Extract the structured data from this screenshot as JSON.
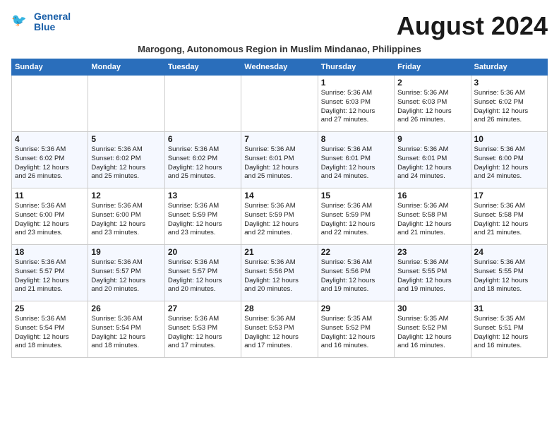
{
  "header": {
    "logo_line1": "General",
    "logo_line2": "Blue",
    "month_title": "August 2024",
    "subtitle": "Marogong, Autonomous Region in Muslim Mindanao, Philippines"
  },
  "weekdays": [
    "Sunday",
    "Monday",
    "Tuesday",
    "Wednesday",
    "Thursday",
    "Friday",
    "Saturday"
  ],
  "weeks": [
    [
      {
        "day": "",
        "detail": ""
      },
      {
        "day": "",
        "detail": ""
      },
      {
        "day": "",
        "detail": ""
      },
      {
        "day": "",
        "detail": ""
      },
      {
        "day": "1",
        "detail": "Sunrise: 5:36 AM\nSunset: 6:03 PM\nDaylight: 12 hours\nand 27 minutes."
      },
      {
        "day": "2",
        "detail": "Sunrise: 5:36 AM\nSunset: 6:03 PM\nDaylight: 12 hours\nand 26 minutes."
      },
      {
        "day": "3",
        "detail": "Sunrise: 5:36 AM\nSunset: 6:02 PM\nDaylight: 12 hours\nand 26 minutes."
      }
    ],
    [
      {
        "day": "4",
        "detail": "Sunrise: 5:36 AM\nSunset: 6:02 PM\nDaylight: 12 hours\nand 26 minutes."
      },
      {
        "day": "5",
        "detail": "Sunrise: 5:36 AM\nSunset: 6:02 PM\nDaylight: 12 hours\nand 25 minutes."
      },
      {
        "day": "6",
        "detail": "Sunrise: 5:36 AM\nSunset: 6:02 PM\nDaylight: 12 hours\nand 25 minutes."
      },
      {
        "day": "7",
        "detail": "Sunrise: 5:36 AM\nSunset: 6:01 PM\nDaylight: 12 hours\nand 25 minutes."
      },
      {
        "day": "8",
        "detail": "Sunrise: 5:36 AM\nSunset: 6:01 PM\nDaylight: 12 hours\nand 24 minutes."
      },
      {
        "day": "9",
        "detail": "Sunrise: 5:36 AM\nSunset: 6:01 PM\nDaylight: 12 hours\nand 24 minutes."
      },
      {
        "day": "10",
        "detail": "Sunrise: 5:36 AM\nSunset: 6:00 PM\nDaylight: 12 hours\nand 24 minutes."
      }
    ],
    [
      {
        "day": "11",
        "detail": "Sunrise: 5:36 AM\nSunset: 6:00 PM\nDaylight: 12 hours\nand 23 minutes."
      },
      {
        "day": "12",
        "detail": "Sunrise: 5:36 AM\nSunset: 6:00 PM\nDaylight: 12 hours\nand 23 minutes."
      },
      {
        "day": "13",
        "detail": "Sunrise: 5:36 AM\nSunset: 5:59 PM\nDaylight: 12 hours\nand 23 minutes."
      },
      {
        "day": "14",
        "detail": "Sunrise: 5:36 AM\nSunset: 5:59 PM\nDaylight: 12 hours\nand 22 minutes."
      },
      {
        "day": "15",
        "detail": "Sunrise: 5:36 AM\nSunset: 5:59 PM\nDaylight: 12 hours\nand 22 minutes."
      },
      {
        "day": "16",
        "detail": "Sunrise: 5:36 AM\nSunset: 5:58 PM\nDaylight: 12 hours\nand 21 minutes."
      },
      {
        "day": "17",
        "detail": "Sunrise: 5:36 AM\nSunset: 5:58 PM\nDaylight: 12 hours\nand 21 minutes."
      }
    ],
    [
      {
        "day": "18",
        "detail": "Sunrise: 5:36 AM\nSunset: 5:57 PM\nDaylight: 12 hours\nand 21 minutes."
      },
      {
        "day": "19",
        "detail": "Sunrise: 5:36 AM\nSunset: 5:57 PM\nDaylight: 12 hours\nand 20 minutes."
      },
      {
        "day": "20",
        "detail": "Sunrise: 5:36 AM\nSunset: 5:57 PM\nDaylight: 12 hours\nand 20 minutes."
      },
      {
        "day": "21",
        "detail": "Sunrise: 5:36 AM\nSunset: 5:56 PM\nDaylight: 12 hours\nand 20 minutes."
      },
      {
        "day": "22",
        "detail": "Sunrise: 5:36 AM\nSunset: 5:56 PM\nDaylight: 12 hours\nand 19 minutes."
      },
      {
        "day": "23",
        "detail": "Sunrise: 5:36 AM\nSunset: 5:55 PM\nDaylight: 12 hours\nand 19 minutes."
      },
      {
        "day": "24",
        "detail": "Sunrise: 5:36 AM\nSunset: 5:55 PM\nDaylight: 12 hours\nand 18 minutes."
      }
    ],
    [
      {
        "day": "25",
        "detail": "Sunrise: 5:36 AM\nSunset: 5:54 PM\nDaylight: 12 hours\nand 18 minutes."
      },
      {
        "day": "26",
        "detail": "Sunrise: 5:36 AM\nSunset: 5:54 PM\nDaylight: 12 hours\nand 18 minutes."
      },
      {
        "day": "27",
        "detail": "Sunrise: 5:36 AM\nSunset: 5:53 PM\nDaylight: 12 hours\nand 17 minutes."
      },
      {
        "day": "28",
        "detail": "Sunrise: 5:36 AM\nSunset: 5:53 PM\nDaylight: 12 hours\nand 17 minutes."
      },
      {
        "day": "29",
        "detail": "Sunrise: 5:35 AM\nSunset: 5:52 PM\nDaylight: 12 hours\nand 16 minutes."
      },
      {
        "day": "30",
        "detail": "Sunrise: 5:35 AM\nSunset: 5:52 PM\nDaylight: 12 hours\nand 16 minutes."
      },
      {
        "day": "31",
        "detail": "Sunrise: 5:35 AM\nSunset: 5:51 PM\nDaylight: 12 hours\nand 16 minutes."
      }
    ]
  ]
}
